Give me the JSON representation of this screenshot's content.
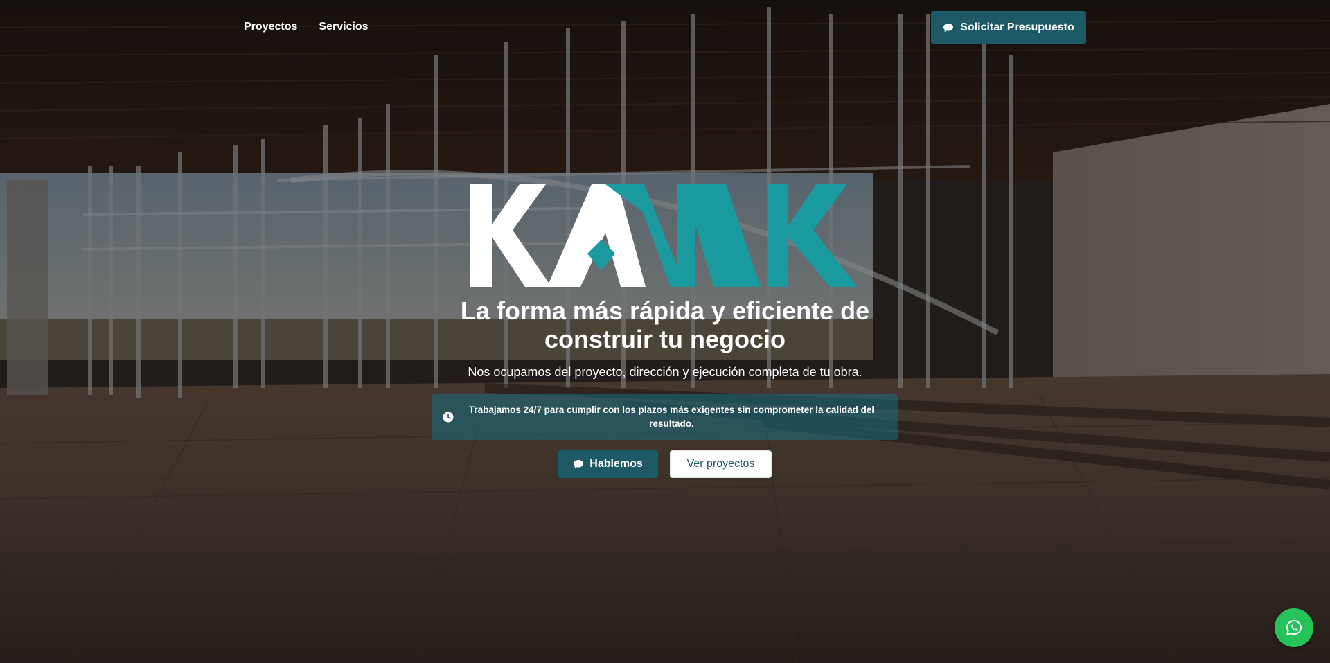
{
  "nav": {
    "items": [
      {
        "label": "Proyectos"
      },
      {
        "label": "Servicios"
      }
    ],
    "cta_label": "Solicitar Presupuesto"
  },
  "brand": {
    "logo_text": "KAMAK",
    "colors": {
      "primary": "#1e5a66",
      "teal": "#1b9aa0",
      "white": "#ffffff",
      "whatsapp": "#25c35a"
    }
  },
  "hero": {
    "headline_line1": "La forma más rápida y eficiente de",
    "headline_line2": "construir tu negocio",
    "subheadline": "Nos ocupamos del proyecto, dirección y ejecución completa de tu obra.",
    "notice_text": "Trabajamos 24/7 para cumplir con los plazos más exigentes sin comprometer la calidad del resultado.",
    "primary_button": "Hablemos",
    "secondary_button": "Ver proyectos"
  },
  "icons": {
    "chat": "chat-bubble-icon",
    "clock": "clock-icon",
    "whatsapp": "whatsapp-icon"
  }
}
